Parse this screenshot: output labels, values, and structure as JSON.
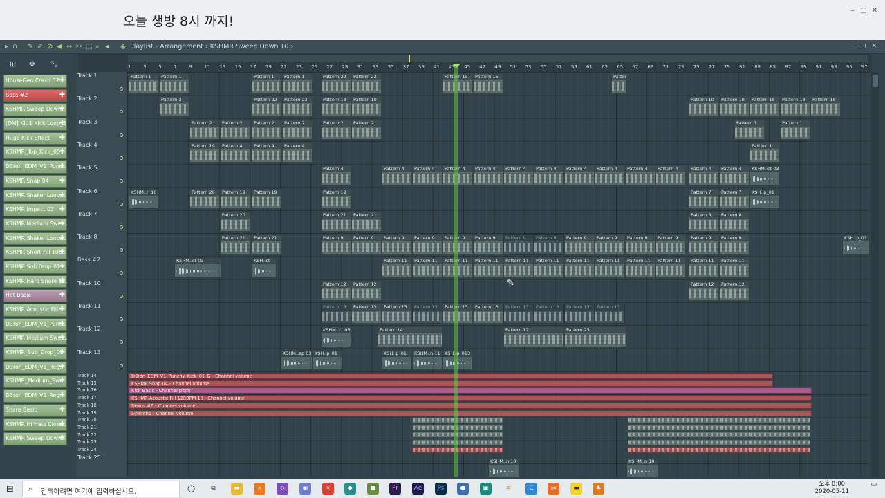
{
  "banner": "오늘 생방 8시 까지!",
  "window": {
    "min": "–",
    "max": "▢",
    "close": "✕"
  },
  "toolbar": {
    "breadcrumb": "Playlist - Arrangement › KSHMR Sweep Down 10 ›"
  },
  "ruler": [
    1,
    3,
    5,
    7,
    9,
    11,
    13,
    15,
    17,
    19,
    21,
    23,
    25,
    27,
    29,
    31,
    33,
    35,
    37,
    39,
    41,
    43,
    45,
    47,
    49,
    51,
    53,
    55,
    57,
    59,
    61,
    63,
    65,
    67,
    69,
    71,
    73,
    75,
    77,
    79,
    81,
    83,
    85,
    87,
    89,
    91,
    93,
    95,
    97
  ],
  "channels": [
    "HouseGen Crash 07",
    "Bass #2",
    "KSHMR Sweep Down..",
    "[DM] Kit 1 Kick Loop_2",
    "Huge Kick Effect",
    "KSHMR_Top_Kick_05",
    "D3ron_EDM_V1_Punc..",
    "KSHMR Snap 04",
    "KSHMR Shaker Loops..",
    "KSHMR Impact 03",
    "KSHMR Medium Swee..",
    "KSHMR Shaker Loops..",
    "KSHMR Short Fill 100..",
    "KSHMR Sub Drop 01 -..",
    "KSHMR Hard Snare 12..",
    "Hat Basic",
    "KSHMR Acoustic Fill 1..",
    "D3ron_EDM_V1_Punc..",
    "KSHMR Medium Swee..",
    "KSHMR_Sub_Drop_01",
    "D3ron_EDM_V1_Reg..",
    "KSHMR_Medium_Swe..",
    "D3ron_EDM_V1_Reg..",
    "Snare Basic",
    "KSHMR Hi Hats Close..",
    "KSHMR Sweep Down.."
  ],
  "tracks": [
    "Track 1",
    "Track 2",
    "Track 3",
    "Track 4",
    "Track 5",
    "Track 6",
    "Track 7",
    "Track 8",
    "Bass #2",
    "Track 10",
    "Track 11",
    "Track 12",
    "Track 13"
  ],
  "small_tracks": [
    "Track 14",
    "Track 15",
    "Track 16",
    "Track 17",
    "Track 18",
    "Track 19",
    "Track 20",
    "Track 21",
    "Track 22",
    "Track 23",
    "Track 24"
  ],
  "track25": "Track 25",
  "automation": [
    "D3ron_EDM_V1_Punchy_Kick_01_G - Channel volume",
    "KSHMR Snap 04 - Channel volume",
    "Kick Basic - Channel pitch",
    "KSHMR Acoustic Fill 128BPM 10 - Channel volume",
    "Nexus #6 - Channel volume",
    "Sylenth1 - Channel volume"
  ],
  "clips": {
    "p1": "Pattern 1",
    "p2": "Pattern 2",
    "p3": "Pattern 3",
    "p4": "Pattern 4",
    "p7": "Pattern 7",
    "p8": "Pattern 8",
    "p9": "Pattern 9",
    "p10": "Pattern 10",
    "p11": "Pattern 11",
    "p12": "Pattern 12",
    "p13": "Pattern 13",
    "p14": "Pattern 14",
    "p15": "Pattern 15",
    "p17": "Pattern 17",
    "p18": "Pattern 18",
    "p19": "Pattern 19",
    "p20": "Pattern 20",
    "p21": "Pattern 21",
    "p22": "Pattern 22",
    "p23": "Pattern 23",
    "a1": "KSHM..n 10",
    "a2": "KSHM..ct 03",
    "a3": "KSH..ct",
    "a4": "KSH..p_01",
    "a5": "KSHM..ct 06",
    "a6": "KSHM..ep 03",
    "a7": "KSH..p_01",
    "a8": "KSH..p_01",
    "a9": "KSHM..n 11",
    "a10": "KSH..p_013",
    "a11": "KSHM..n 10",
    "a12": "KSHM..n 10"
  },
  "taskbar": {
    "search": "검색하려면 여기에 입력하십시오.",
    "time": "오후 8:00",
    "date": "2020-05-11"
  }
}
